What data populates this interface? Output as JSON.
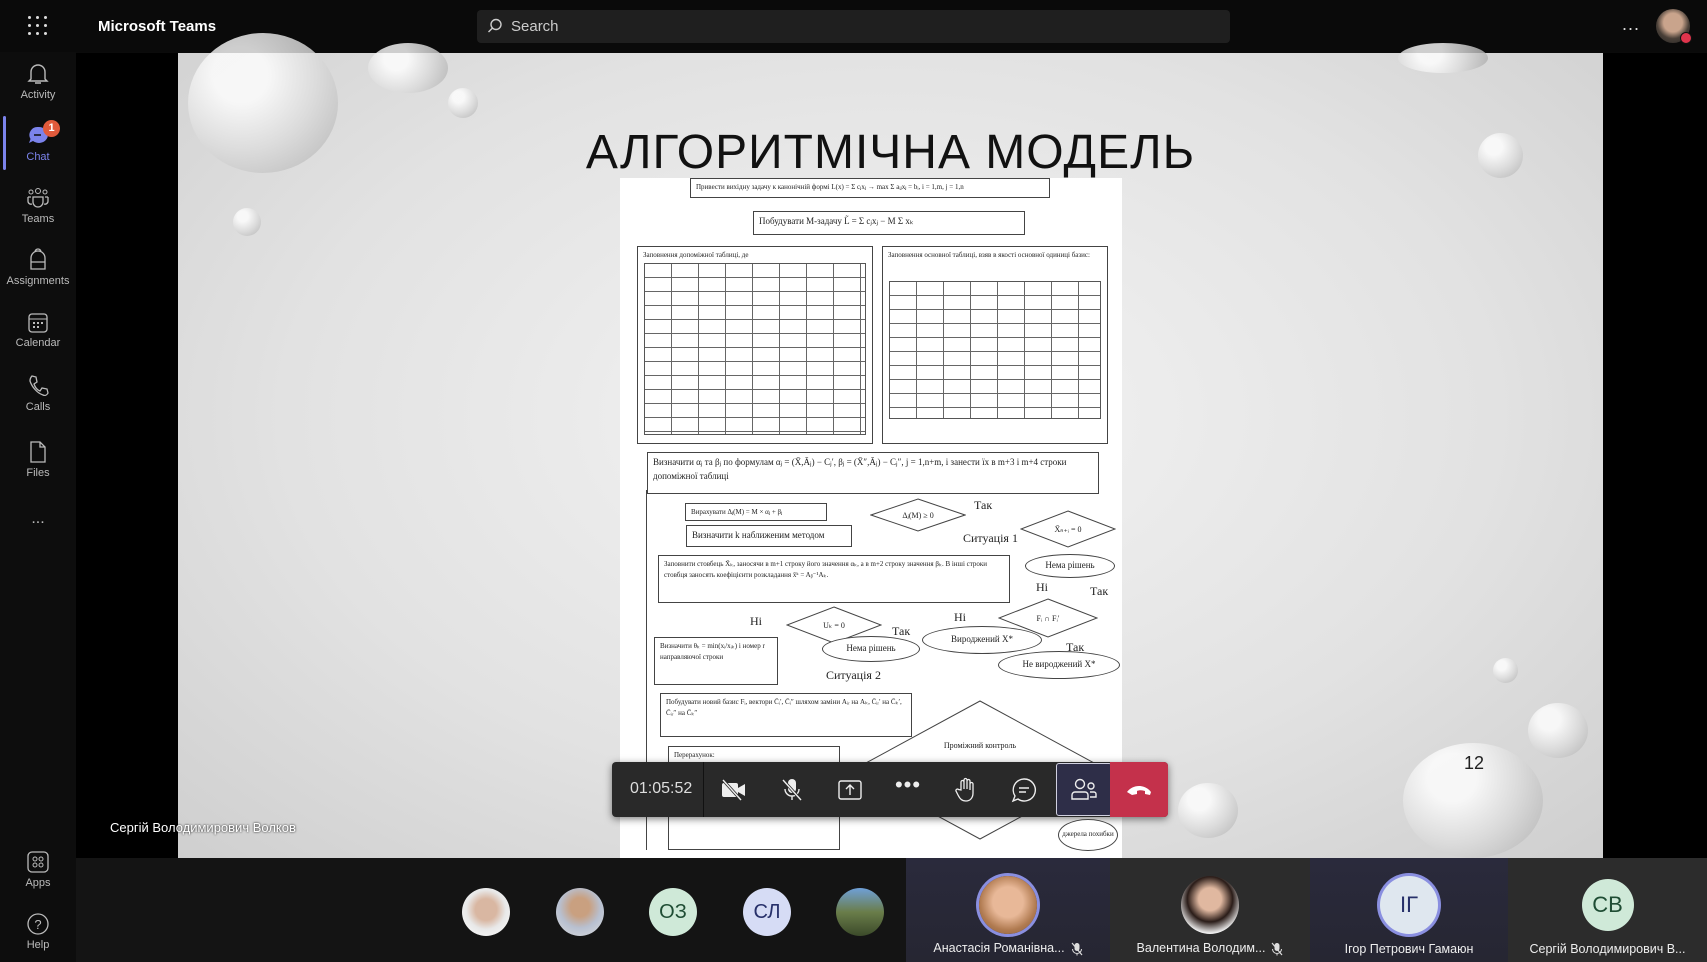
{
  "app": {
    "title": "Microsoft Teams",
    "search_placeholder": "Search",
    "more": "...",
    "accent": "#7b83eb"
  },
  "sidebar": {
    "items": [
      {
        "label": "Activity",
        "icon": "bell-icon"
      },
      {
        "label": "Chat",
        "icon": "chat-icon",
        "badge": "1",
        "active": true
      },
      {
        "label": "Teams",
        "icon": "teams-icon"
      },
      {
        "label": "Assignments",
        "icon": "backpack-icon"
      },
      {
        "label": "Calendar",
        "icon": "calendar-icon"
      },
      {
        "label": "Calls",
        "icon": "phone-icon"
      },
      {
        "label": "Files",
        "icon": "file-icon"
      }
    ],
    "more": "...",
    "apps": "Apps",
    "help": "Help"
  },
  "slide": {
    "title": "АЛГОРИТМІЧНА МОДЕЛЬ",
    "page_number": "12",
    "flow": {
      "b1": "Привести вихідну задачу к канонічній формі L(x) = Σ cⱼxⱼ → max Σ aᵢⱼxⱼ = bᵢ, i = 1,m, j = 1,n",
      "b2": "Побудувати М-задачу L̃ = Σ cⱼxⱼ − M Σ xₖ",
      "b3": "Заповнення допоміжної таблиці, де",
      "b4": "Заповнення основної таблиці, взяв в якості основної одиниці базис:",
      "b5": "Визначити αⱼ та βⱼ по формулам αⱼ = (X̄,Āⱼ) − Cⱼ′, βⱼ = (X̄″,Āⱼ) − Cⱼ″, j = 1,n+m, і занести їх в m+3 і m+4 строки допоміжної таблиці",
      "b6": "Вирахувати Δⱼ(M) = M × αⱼ + βⱼ",
      "b7": "Визначити k наближеним методом",
      "b8": "Заповнити стовбець X̄ₖ, заносячи в m+1 строку його значення αₖ, а в m+2 строку значення βₖ. В інші строки стовбця заносять коефіцієнти розкладання x̄ᵏ = Aᵦ⁻¹Aₖ.",
      "d1": "Δⱼ(M) ≥ 0",
      "d2": "X̄ₙ₊ᵢ = 0",
      "d3": "Uₖ = 0",
      "d4": "Fᵢ ∩ Fᵢ′",
      "e1": "Нема рішень",
      "e2": "Нема рішень",
      "e3": "Вироджений X*",
      "e4": "Не вироджений X*",
      "b9": "Визначити θₖ = min(xᵢ/xᵢₖ) і номер r направляючої строки",
      "b10": "Побудувати новий базис Fᵢ, вектори C̄ᵢ′, C̄ᵢ″ шляхом заміни Aᵢᵣ на Aₖ, C̄ᵢᵣ′ на C̄ₖ′, C̄ᵢᵣ″ на C̄ₖ″",
      "b11": "Перерахунок:",
      "b12": "Проміжний контроль",
      "e5": "джерела похибки",
      "l_tak1": "Так",
      "l_sit1": "Ситуація 1",
      "l_ni1": "Ні",
      "l_tak2": "Так",
      "l_ni2": "Ні",
      "l_tak3": "Так",
      "l_ni3": "Ні",
      "l_tak4": "Так",
      "l_sit2": "Ситуація 2"
    }
  },
  "presenter": "Сергій Володимирович Волков",
  "call": {
    "timer": "01:05:52",
    "controls": [
      "camera-off",
      "mic-off",
      "share",
      "more",
      "raise-hand",
      "chat",
      "participants",
      "leave"
    ],
    "leave_color": "#c4314b"
  },
  "participants": {
    "small": [
      {
        "type": "photo"
      },
      {
        "type": "photo"
      },
      {
        "initials": "ОЗ",
        "bg": "#cfe9d8",
        "fg": "#1f4d34"
      },
      {
        "initials": "СЛ",
        "bg": "#d6dcf5",
        "fg": "#27306a"
      },
      {
        "type": "photo"
      }
    ],
    "tiles": [
      {
        "name": "Анастасія Романівна...",
        "muted": true,
        "speaking": true,
        "type": "photo"
      },
      {
        "name": "Валентина Володим...",
        "muted": true,
        "speaking": false,
        "type": "photo"
      },
      {
        "name": "Ігор Петрович Гамаюн",
        "initials": "ІГ",
        "speaking": true,
        "muted": false,
        "bg": "#dfe7ef",
        "fg": "#27306a"
      },
      {
        "name": "Сергій Володимирович В...",
        "initials": "СВ",
        "speaking": false,
        "muted": false,
        "bg": "#cfe9d8",
        "fg": "#1f4d34"
      }
    ]
  }
}
